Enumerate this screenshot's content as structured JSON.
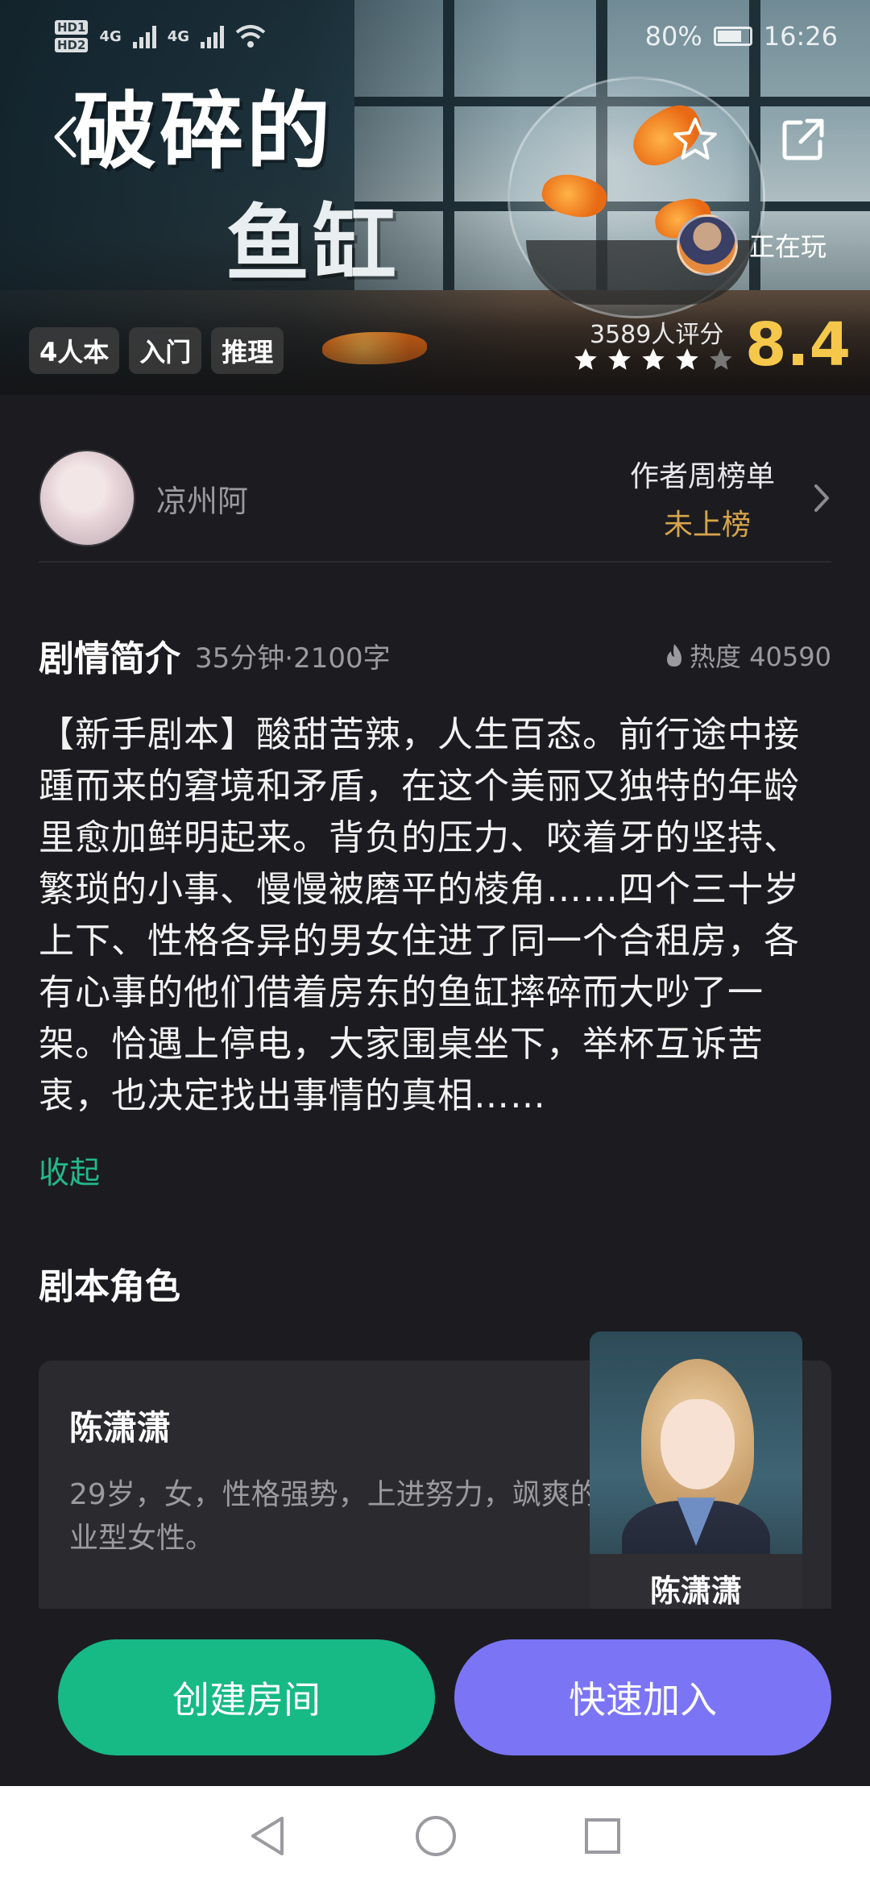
{
  "status_bar": {
    "hd_badges": [
      "HD1",
      "HD2"
    ],
    "network_1": "4G",
    "network_2": "4G",
    "battery_percent": "80%",
    "time": "16:26"
  },
  "hero": {
    "title_line1": "破碎的",
    "title_line2": "鱼缸",
    "playing_label": "正在玩",
    "tags": [
      "4人本",
      "入门",
      "推理"
    ],
    "rating_count": "3589人评分",
    "score": "8.4",
    "stars_filled": 4,
    "stars_total": 5
  },
  "author": {
    "name": "凉州阿",
    "weekly_rank_title": "作者周榜单",
    "weekly_rank_value": "未上榜"
  },
  "synopsis": {
    "title": "剧情简介",
    "meta": "35分钟·2100字",
    "heat": "热度 40590",
    "text": "【新手剧本】酸甜苦辣，人生百态。前行途中接踵而来的窘境和矛盾，在这个美丽又独特的年龄里愈加鲜明起来。背负的压力、咬着牙的坚持、繁琐的小事、慢慢被磨平的棱角……四个三十岁上下、性格各异的男女住进了同一个合租房，各有心事的他们借着房东的鱼缸摔碎而大吵了一架。恰遇上停电，大家围桌坐下，举杯互诉苦衷，也决定找出事情的真相……",
    "collapse": "收起"
  },
  "roles": {
    "title": "剧本角色",
    "items": [
      {
        "name": "陈潇潇",
        "description": "29岁，女，性格强势，上进努力，飒爽的事业型女性。",
        "portrait_label": "陈潇潇"
      }
    ]
  },
  "actions": {
    "create_room": "创建房间",
    "quick_join": "快速加入"
  },
  "colors": {
    "background": "#1c1c20",
    "accent_green": "#17b985",
    "accent_purple": "#7b75f6",
    "score_gold": "#f5c84b",
    "rank_gold": "#d7a54a",
    "link_green": "#22b98c"
  }
}
